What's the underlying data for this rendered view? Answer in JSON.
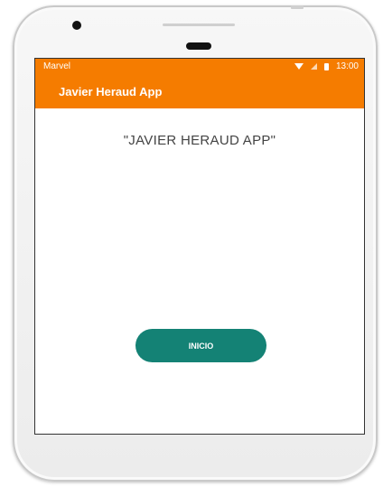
{
  "status_bar": {
    "carrier": "Marvel",
    "time": "13:00",
    "icons": [
      "wifi-icon",
      "signal-icon",
      "battery-icon"
    ]
  },
  "app_bar": {
    "title": "Javier Heraud App"
  },
  "main": {
    "headline": "\"JAVIER HERAUD APP\"",
    "start_button_label": "INICIO"
  },
  "colors": {
    "accent": "#f57c00",
    "button": "#148275"
  }
}
